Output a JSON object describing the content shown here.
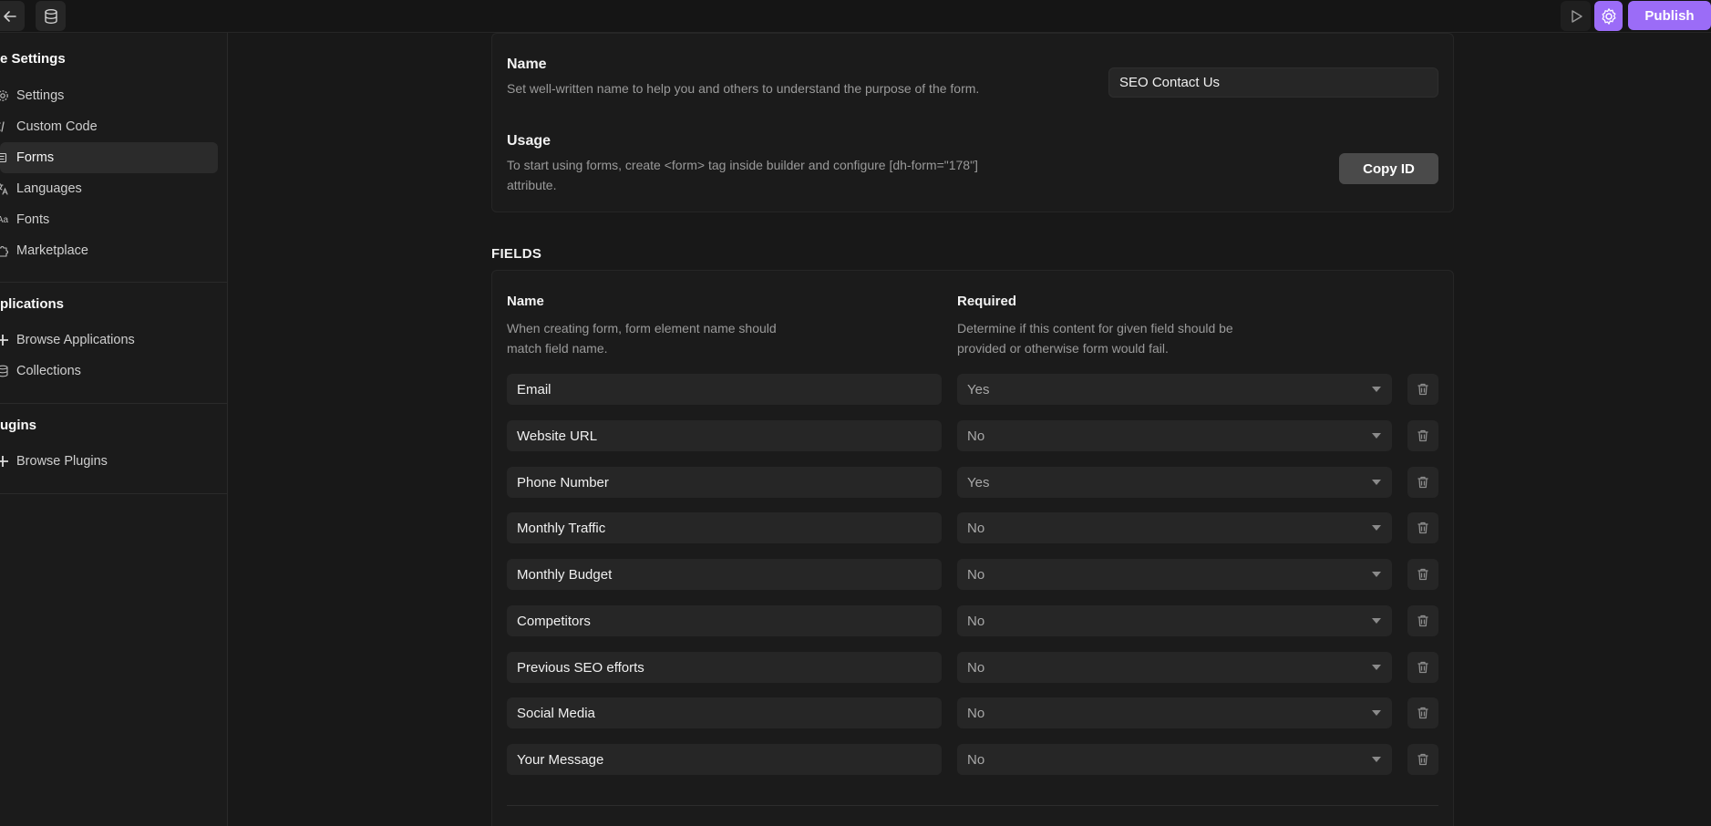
{
  "topbar": {
    "publish_label": "Publish"
  },
  "sidebar": {
    "section1_title": "e Settings",
    "section1_items": [
      {
        "label": "Settings",
        "icon": "gear-icon"
      },
      {
        "label": "Custom Code",
        "icon": "code-icon"
      },
      {
        "label": "Forms",
        "icon": "list-icon"
      },
      {
        "label": "Languages",
        "icon": "translate-icon"
      },
      {
        "label": "Fonts",
        "icon": "font-icon"
      },
      {
        "label": "Marketplace",
        "icon": "puzzle-icon"
      }
    ],
    "section2_title": "plications",
    "section2_items": [
      {
        "label": "Browse Applications",
        "icon": "plus-icon"
      },
      {
        "label": "Collections",
        "icon": "database-icon"
      }
    ],
    "section3_title": "ugins",
    "section3_items": [
      {
        "label": "Browse Plugins",
        "icon": "plus-icon"
      }
    ]
  },
  "form": {
    "name_title": "Name",
    "name_desc": "Set well-written name to help you and others to understand the purpose of the form.",
    "name_value": "SEO Contact Us",
    "usage_title": "Usage",
    "usage_desc_line1": "To start using forms, create <form> tag inside builder and configure [dh-form=\"178\"]",
    "usage_desc_line2": "attribute.",
    "copy_label": "Copy ID"
  },
  "fields": {
    "section_title": "FIELDS",
    "name_col_title": "Name",
    "name_col_desc_line1": "When creating form, form element name should",
    "name_col_desc_line2": "match field name.",
    "req_col_title": "Required",
    "req_col_desc_line1": "Determine if this content for given field should be",
    "req_col_desc_line2": "provided or otherwise form would fail.",
    "rows": [
      {
        "name": "Email",
        "required": "Yes"
      },
      {
        "name": "Website URL",
        "required": "No"
      },
      {
        "name": "Phone Number",
        "required": "Yes"
      },
      {
        "name": "Monthly Traffic",
        "required": "No"
      },
      {
        "name": "Monthly Budget",
        "required": "No"
      },
      {
        "name": "Competitors",
        "required": "No"
      },
      {
        "name": "Previous SEO efforts",
        "required": "No"
      },
      {
        "name": "Social Media",
        "required": "No"
      },
      {
        "name": "Your Message",
        "required": "No"
      }
    ]
  },
  "colors": {
    "accent": "#9b6cf7",
    "background": "#181818"
  }
}
